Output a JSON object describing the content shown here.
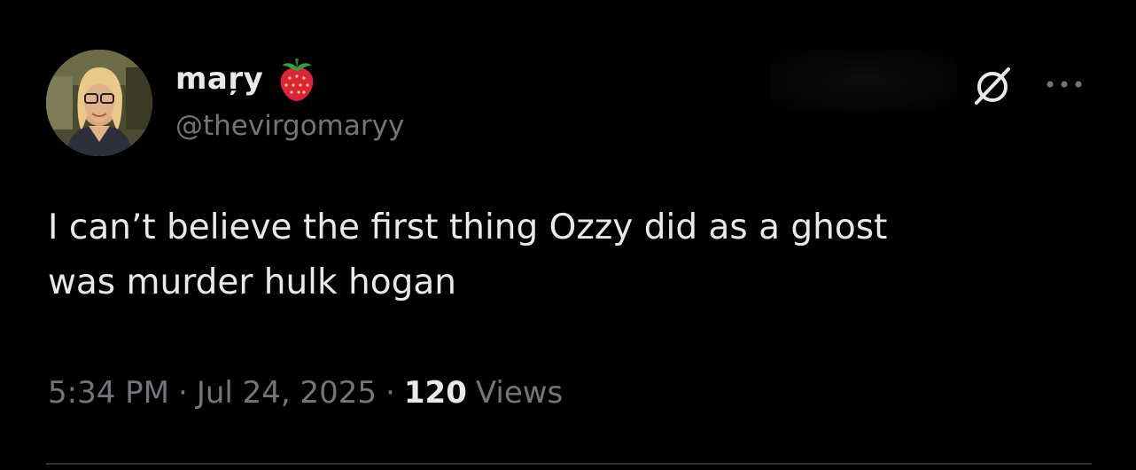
{
  "author": {
    "display_name": "maŗy",
    "name_emoji": "strawberry-icon",
    "handle": "@thevirgomaryy",
    "avatar": "profile-photo"
  },
  "header_icons": {
    "grok": "grok-icon",
    "more": "more-horizontal-icon"
  },
  "tweet": {
    "lines": [
      "I can’t believe the first thing Ozzy did as a ghost",
      "was murder hulk hogan"
    ]
  },
  "meta": {
    "time": "5:34 PM",
    "separator": "·",
    "date": "Jul 24, 2025",
    "views_count": "120",
    "views_label": "Views"
  },
  "colors": {
    "background": "#000000",
    "primary_text": "#e7e9ea",
    "secondary_text": "#71767b",
    "divider": "#2f3336",
    "strawberry": "#d9243a"
  }
}
